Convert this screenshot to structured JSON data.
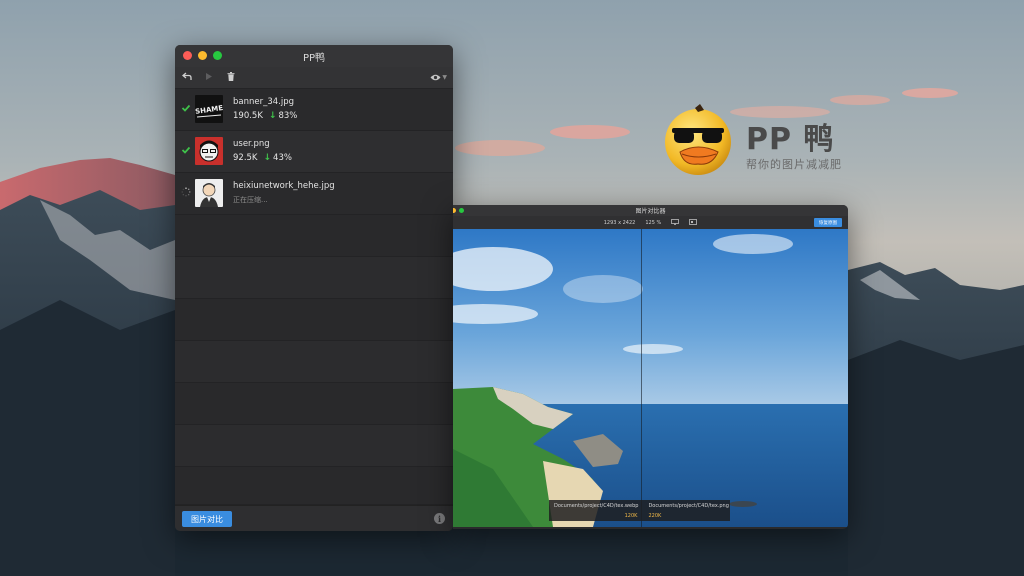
{
  "main_window": {
    "title": "PP鸭",
    "toolbar": {
      "undo_icon": "undo-icon",
      "play_icon": "play-icon",
      "trash_icon": "trash-icon",
      "eye_icon": "eye-icon"
    },
    "files": [
      {
        "name": "banner_34.jpg",
        "size": "190.5K",
        "saved": "83%",
        "status": "done"
      },
      {
        "name": "user.png",
        "size": "92.5K",
        "saved": "43%",
        "status": "done"
      },
      {
        "name": "heixiunetwork_hehe.jpg",
        "status": "compressing",
        "status_text": "正在压缩..."
      }
    ],
    "compare_button": "图片对比"
  },
  "compare_window": {
    "title": "图片对比器",
    "dimensions": "1293 x 2422",
    "zoom": "125 %",
    "replace_button": "恢复原图",
    "left": {
      "path": "Documents/project/C4D/tex.webp",
      "size": "120K"
    },
    "right": {
      "path": "Documents/project/C4D/tex.png",
      "size": "220K"
    }
  },
  "logo": {
    "name": "PP 鸭",
    "tagline": "帮你的图片减减肥"
  },
  "colors": {
    "accent": "#3a8de0",
    "success": "#3fc24a",
    "size_highlight": "#f0b848"
  }
}
